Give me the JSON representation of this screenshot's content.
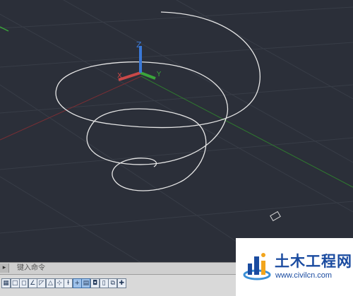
{
  "viewport": {
    "ucs_icon": {
      "x_label": "X",
      "y_label": "Y",
      "z_label": "Z"
    },
    "colors": {
      "background": "#2b2f39",
      "grid": "#3a3f4a",
      "x_axis": "#c04040",
      "y_axis": "#3aa43a",
      "z_axis": "#3a78d6",
      "helix": "#e6e6e6"
    }
  },
  "command_line": {
    "prompt": "键入命令"
  },
  "status_toolbar": {
    "buttons": [
      {
        "icon": "snap-mode-icon",
        "glyph": "▦"
      },
      {
        "icon": "grid-display-icon",
        "glyph": "□"
      },
      {
        "icon": "ortho-mode-icon",
        "glyph": "◻"
      },
      {
        "icon": "polar-tracking-icon",
        "glyph": "∠"
      },
      {
        "icon": "object-snap-icon",
        "glyph": "◸"
      },
      {
        "icon": "3d-object-snap-icon",
        "glyph": "△"
      },
      {
        "icon": "object-snap-tracking-icon",
        "glyph": "⊹"
      },
      {
        "icon": "dynamic-ucs-icon",
        "glyph": "ɫ"
      },
      {
        "icon": "dynamic-input-icon",
        "glyph": "+"
      },
      {
        "icon": "lineweight-icon",
        "glyph": "▤"
      },
      {
        "icon": "transparency-icon",
        "glyph": "◘"
      },
      {
        "icon": "quick-properties-icon",
        "glyph": "▯"
      },
      {
        "icon": "selection-cycling-icon",
        "glyph": "⧉"
      },
      {
        "icon": "annotation-monitor-icon",
        "glyph": "✚"
      }
    ]
  },
  "watermark": {
    "title": "土木工程网",
    "url": "www.civilcn.com"
  }
}
